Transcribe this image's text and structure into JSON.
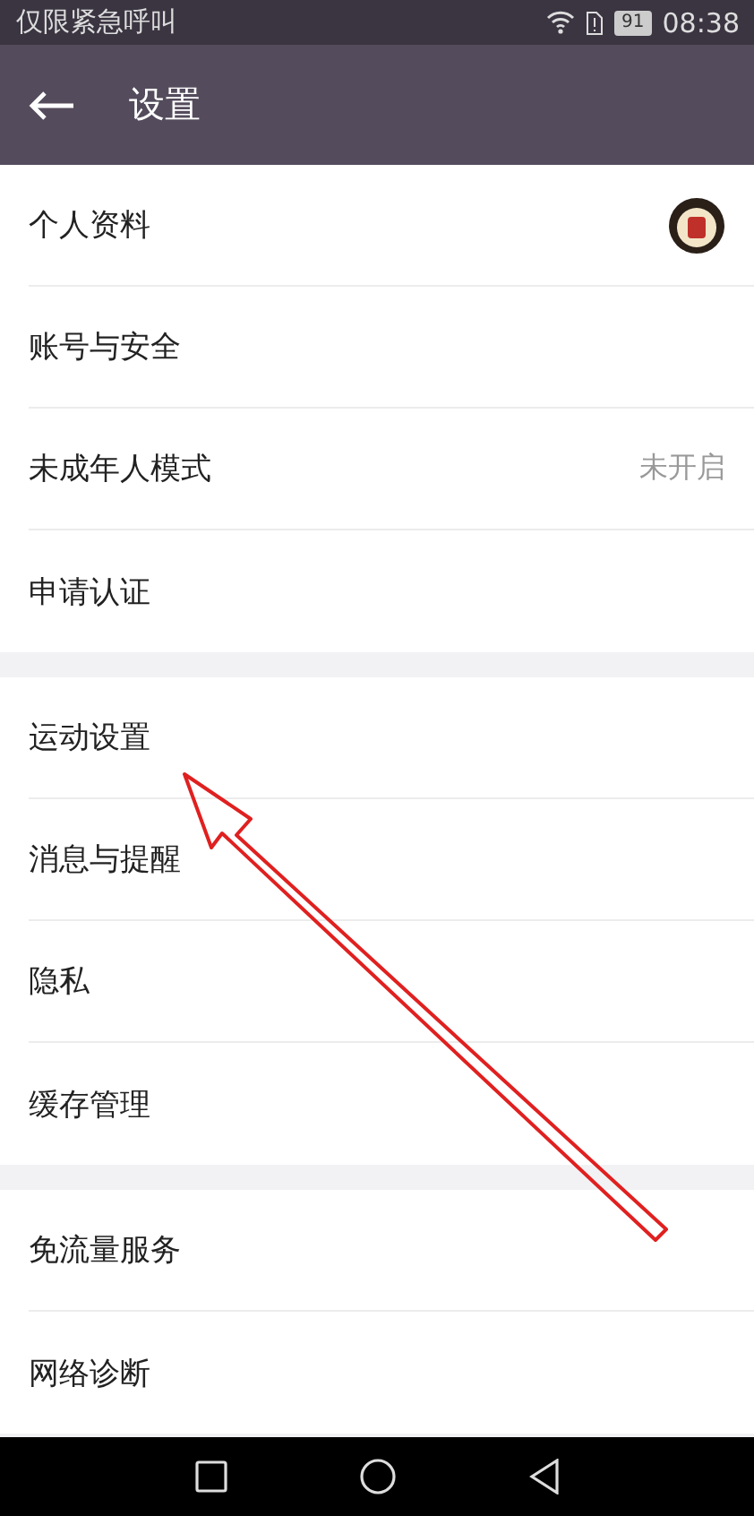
{
  "status_bar": {
    "carrier": "仅限紧急呼叫",
    "battery": "91",
    "time": "08:38"
  },
  "header": {
    "title": "设置"
  },
  "groups": [
    {
      "items": [
        {
          "label": "个人资料",
          "kind": "avatar"
        },
        {
          "label": "账号与安全",
          "kind": "plain"
        },
        {
          "label": "未成年人模式",
          "kind": "value",
          "value": "未开启"
        },
        {
          "label": "申请认证",
          "kind": "plain"
        }
      ]
    },
    {
      "items": [
        {
          "label": "运动设置",
          "kind": "plain"
        },
        {
          "label": "消息与提醒",
          "kind": "plain"
        },
        {
          "label": "隐私",
          "kind": "plain"
        },
        {
          "label": "缓存管理",
          "kind": "plain"
        }
      ]
    },
    {
      "items": [
        {
          "label": "免流量服务",
          "kind": "plain"
        },
        {
          "label": "网络诊断",
          "kind": "plain"
        }
      ]
    }
  ],
  "annotation": {
    "kind": "arrow",
    "color": "#e02020"
  }
}
